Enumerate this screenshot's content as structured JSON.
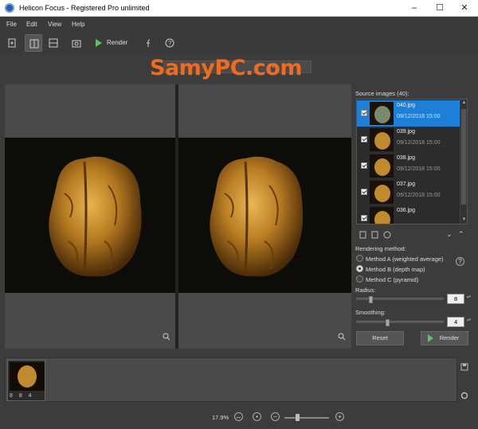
{
  "window": {
    "title": "Helicon Focus - Registered Pro unlimited"
  },
  "menu": [
    "File",
    "Edit",
    "View",
    "Help"
  ],
  "toolbar": {
    "render_label": "Render"
  },
  "watermark": "SamyPC.com",
  "view_tabs": [
    "",
    "Te"
  ],
  "source_images": {
    "label": "Source images (40):",
    "items": [
      {
        "name": "040.jpg",
        "date": "09/12/2018 15:00",
        "selected": true
      },
      {
        "name": "039.jpg",
        "date": "09/12/2018 15:00",
        "selected": false
      },
      {
        "name": "038.jpg",
        "date": "09/12/2018 15:00",
        "selected": false
      },
      {
        "name": "037.jpg",
        "date": "09/12/2018 15:00",
        "selected": false
      },
      {
        "name": "036.jpg",
        "date": "",
        "selected": false
      }
    ]
  },
  "rendering": {
    "label": "Rendering method:",
    "methods": [
      "Method A (weighted average)",
      "Method B (depth map)",
      "Method C (pyramid)"
    ],
    "selected_index": 1,
    "radius_label": "Radius:",
    "radius_value": "8",
    "radius_fraction": 0.15,
    "smoothing_label": "Smoothing:",
    "smoothing_value": "4",
    "smoothing_fraction": 0.35,
    "reset_label": "Reset",
    "render_label": "Render"
  },
  "filmstrip": {
    "item_label": "8 8 4"
  },
  "status": {
    "zoom": "17.9%",
    "zoom_fraction": 0.3
  },
  "colors": {
    "accent": "#1e7fd8",
    "render_green": "#5ec25e",
    "watermark": "#f26b1d"
  }
}
